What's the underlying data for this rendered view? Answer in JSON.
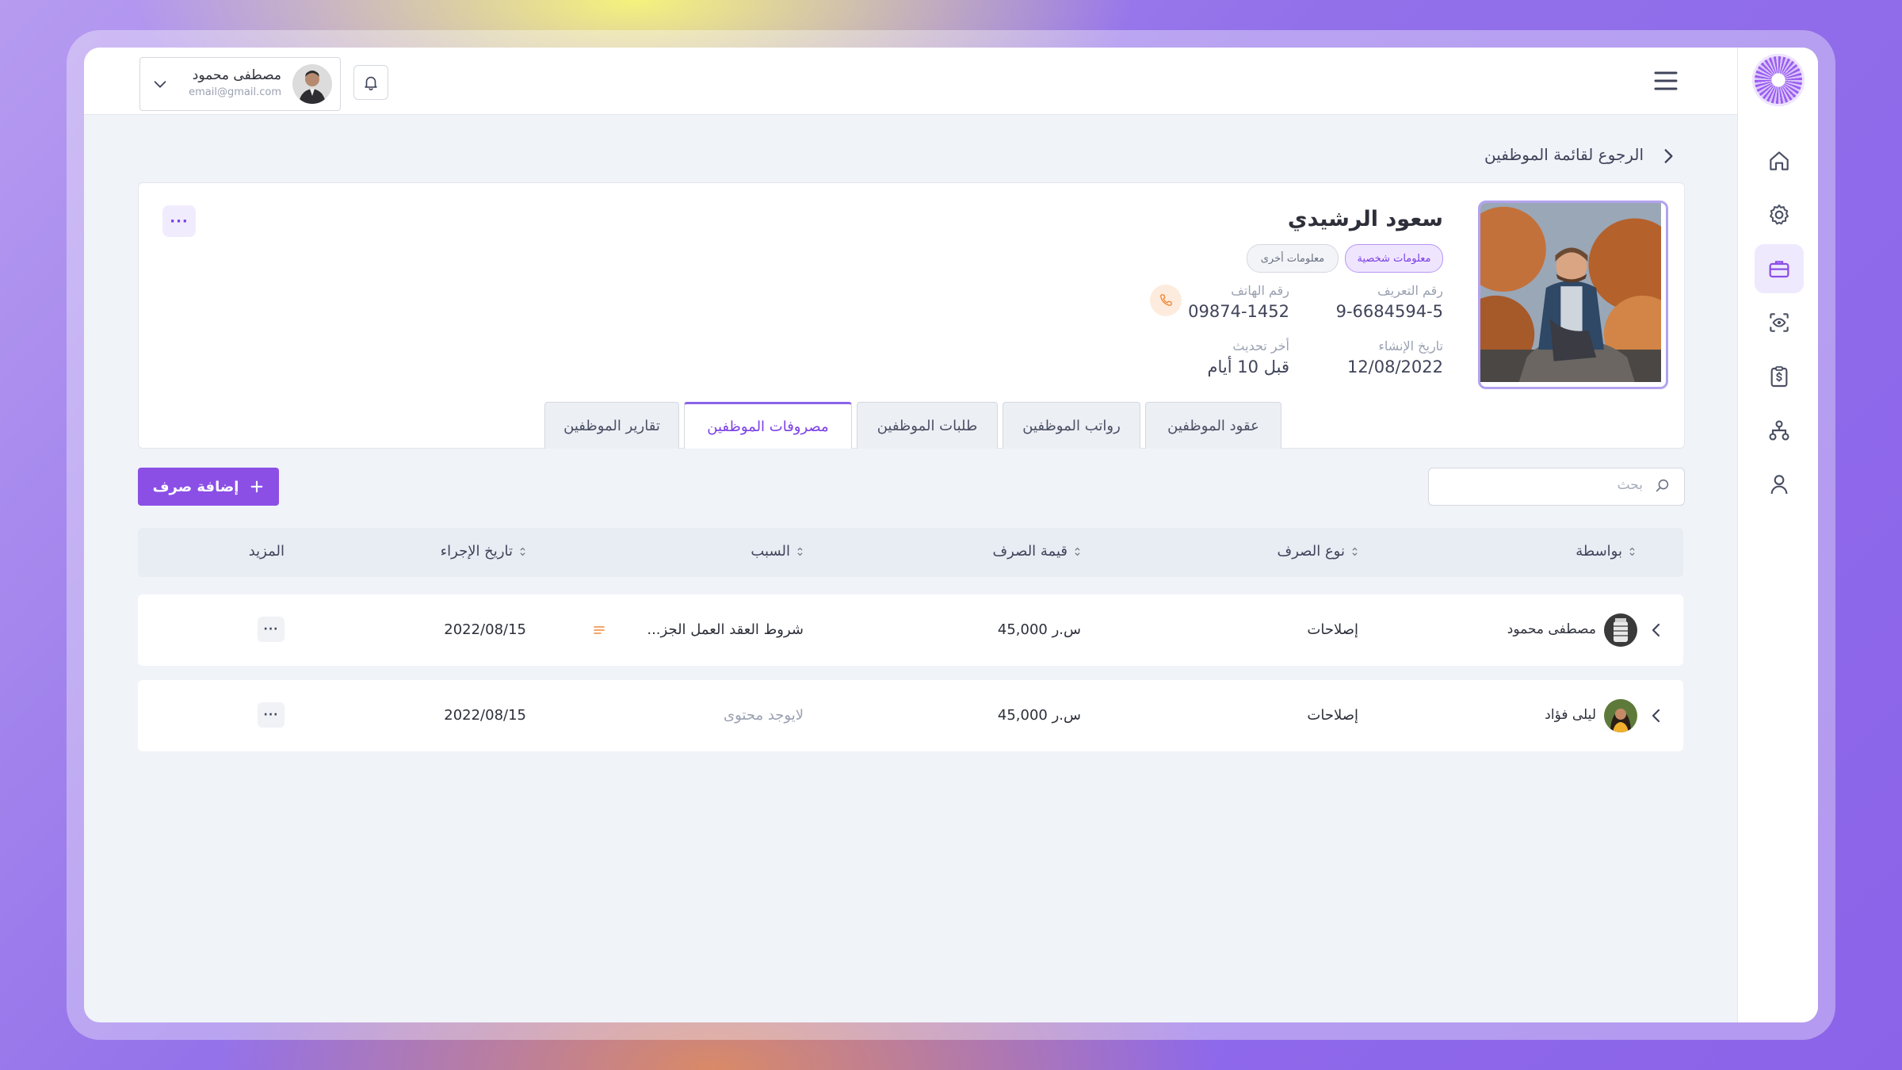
{
  "header": {
    "user_name": "مصطفى محمود",
    "user_email": "email@gmail.com"
  },
  "breadcrumb": {
    "back_label": "الرجوع لقائمة الموظفين"
  },
  "employee": {
    "name": "سعود الرشيدي",
    "pills": [
      "معلومات شخصية",
      "معلومات أخرى"
    ],
    "id_label": "رقم التعريف",
    "id_value": "9-6684594-5",
    "phone_label": "رقم الهاتف",
    "phone_value": "09874-1452",
    "created_label": "تاريخ الإنشاء",
    "created_value": "12/08/2022",
    "updated_label": "أخر تحديث",
    "updated_value": "قبل 10 أيام",
    "more_label": "···"
  },
  "tabs": [
    "عقود الموظفين",
    "رواتب الموظفين",
    "طلبات الموظفين",
    "مصروفات الموظفين",
    "تقارير الموظفين"
  ],
  "active_tab": "مصروفات الموظفين",
  "toolbar": {
    "search_placeholder": "بحث",
    "add_label": "إضافة صرف"
  },
  "table": {
    "columns": [
      "بواسطة",
      "نوع الصرف",
      "قيمة الصرف",
      "السبب",
      "تاريخ الإجراء",
      "المزيد"
    ],
    "rows": [
      {
        "by": "مصطفى محمود",
        "type": "إصلاحات",
        "amount": "45,000 س.ر",
        "reason": "...شروط العقد العمل الجز",
        "date": "2022/08/15",
        "more": "···"
      },
      {
        "by": "ليلى فؤاد",
        "type": "إصلاحات",
        "amount": "45,000 س.ر",
        "reason": "لايوجد محتوى",
        "date": "2022/08/15",
        "more": "···"
      }
    ]
  },
  "colors": {
    "accent": "#8b4fe6",
    "accent_light": "#efe5ff",
    "background": "#f0f3f8"
  },
  "icons": [
    "home-icon",
    "settings-icon",
    "briefcase-icon",
    "scan-icon",
    "clipboard-dollar-icon",
    "org-chart-icon",
    "user-icon"
  ]
}
